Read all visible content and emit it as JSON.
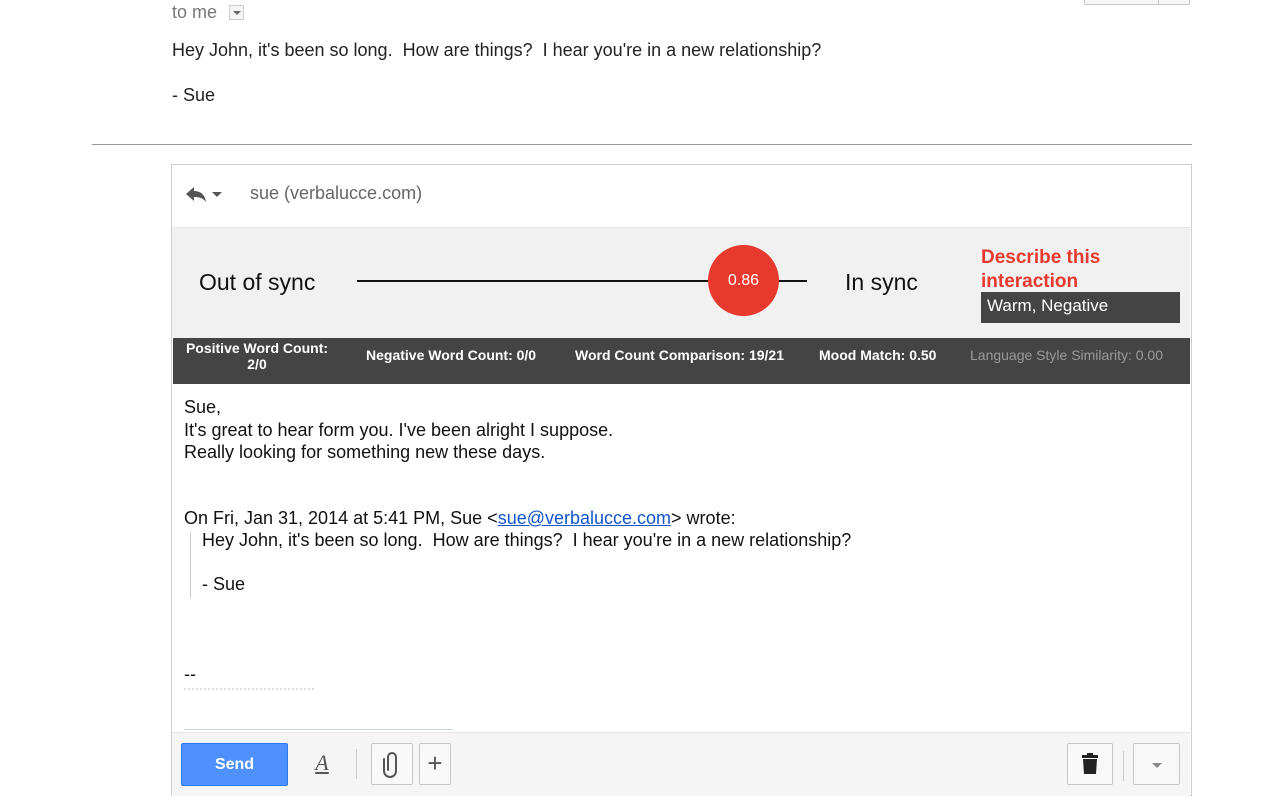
{
  "message": {
    "to_label": "to me",
    "lines": [
      "Hey John, it's been so long.  How are things?  I hear you're in a new relationship?",
      "- Sue"
    ]
  },
  "compose": {
    "recipient": "sue (verbalucce.com)",
    "sync": {
      "left_label": "Out of sync",
      "right_label": "In sync",
      "score_text": "0.86",
      "score": 0.86,
      "describe_label": "Describe this interaction",
      "description": "Warm, Negative"
    },
    "stats": {
      "positive_label": "Positive Word Count:",
      "positive_value": "2/0",
      "negative": "Negative Word Count: 0/0",
      "word_count": "Word Count Comparison: 19/21",
      "mood": "Mood Match: 0.50",
      "style": "Language Style Similarity: 0.00"
    },
    "body": [
      "Sue,",
      "It's great to hear form you.  I've been alright I suppose.",
      "Really looking for something new these days."
    ],
    "quote": {
      "prefix": "On Fri, Jan 31, 2014 at 5:41 PM, Sue <",
      "email": "sue@verbalucce.com",
      "suffix": "> wrote:",
      "lines": [
        "Hey John, it's been so long.  How are things?  I hear you're in a new relationship?",
        "- Sue"
      ]
    },
    "signature": "--",
    "send_label": "Send",
    "format_label": "A",
    "plus_label": "+"
  },
  "colors": {
    "accent_red": "#e8392f",
    "send_blue": "#4d90fe",
    "stats_bg": "#444444",
    "link": "#1155cc"
  },
  "icons": [
    "reply-icon",
    "chevron-down-icon",
    "paperclip-icon",
    "plus-icon",
    "trash-icon",
    "more-options-icon",
    "format-text-icon"
  ]
}
